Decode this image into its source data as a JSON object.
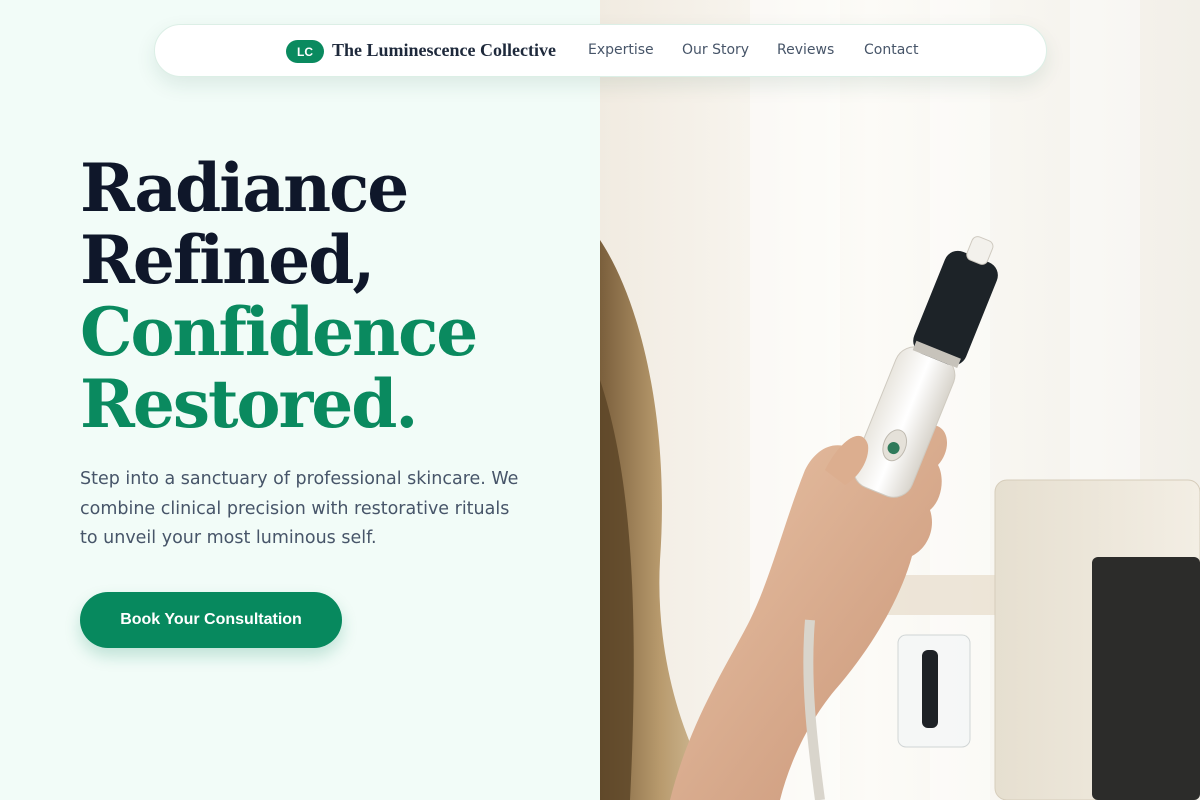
{
  "nav": {
    "logo_badge": "LC",
    "brand": "The Luminescence Collective",
    "links": [
      {
        "label": "Expertise"
      },
      {
        "label": "Our Story"
      },
      {
        "label": "Reviews"
      },
      {
        "label": "Contact"
      }
    ]
  },
  "hero": {
    "headline_line1": "Radiance",
    "headline_line2": "Refined,",
    "headline_line3": "Confidence",
    "headline_line4": "Restored.",
    "subtext": "Step into a sanctuary of professional skincare. We combine clinical precision with restorative rituals to unveil your most luminous self.",
    "cta_label": "Book Your Consultation"
  },
  "colors": {
    "accent": "#0a8a5f",
    "background": "#f2fcf8",
    "heading": "#0f172a",
    "body_text": "#475569"
  },
  "photo": {
    "icon": "skincare-treatment-photo"
  }
}
